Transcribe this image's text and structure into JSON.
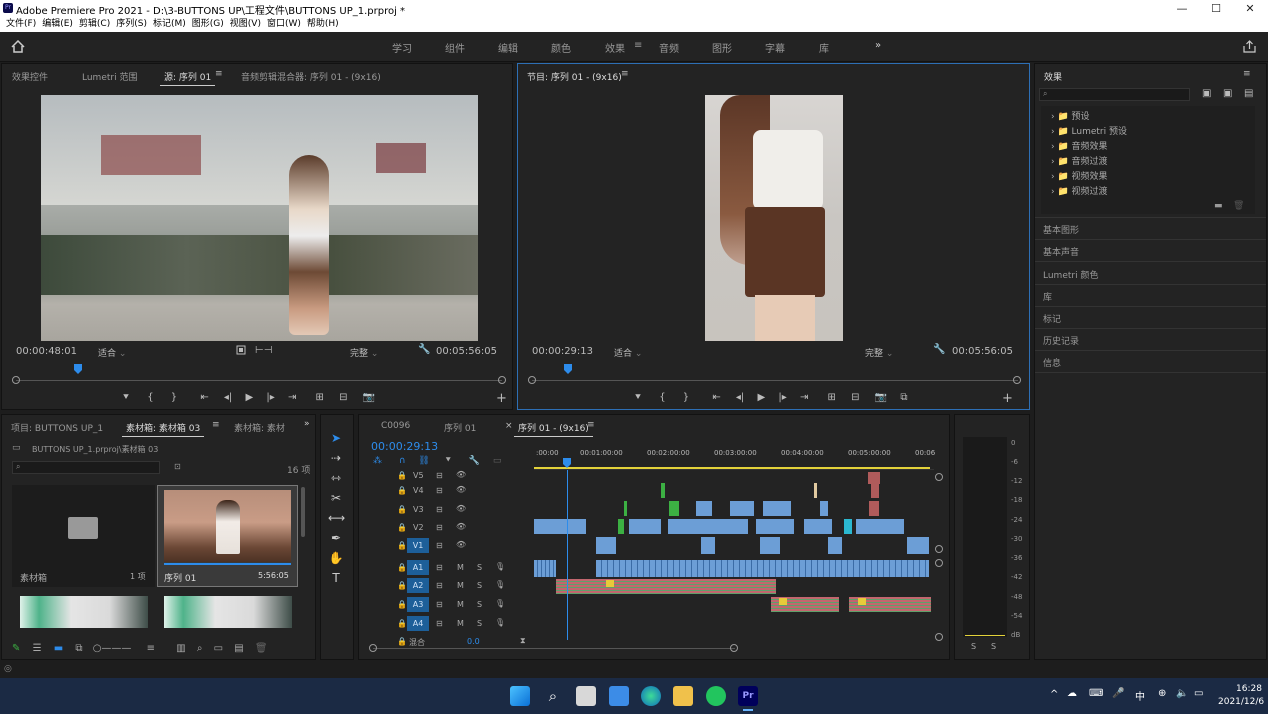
{
  "window": {
    "title": "Adobe Premiere Pro 2021 - D:\\3-BUTTONS UP\\工程文件\\BUTTONS UP_1.prproj *",
    "logo": "Pr"
  },
  "menu": [
    "文件(F)",
    "编辑(E)",
    "剪辑(C)",
    "序列(S)",
    "标记(M)",
    "图形(G)",
    "视图(V)",
    "窗口(W)",
    "帮助(H)"
  ],
  "workspaces": [
    {
      "label": "学习",
      "active": false
    },
    {
      "label": "组件",
      "active": false
    },
    {
      "label": "编辑",
      "active": false
    },
    {
      "label": "颜色",
      "active": false
    },
    {
      "label": "效果",
      "active": true
    },
    {
      "label": "音频",
      "active": false
    },
    {
      "label": "图形",
      "active": false
    },
    {
      "label": "字幕",
      "active": false
    },
    {
      "label": "库",
      "active": false
    }
  ],
  "source": {
    "tabs": [
      "效果控件",
      "Lumetri 范围",
      "源: 序列 01",
      "音频剪辑混合器: 序列 01 - (9x16)"
    ],
    "timecode": "00:00:48:01",
    "fit": "适合",
    "quality": "完整",
    "duration": "00:05:56:05"
  },
  "program": {
    "title": "节目: 序列 01 - (9x16)",
    "timecode": "00:00:29:13",
    "fit": "适合",
    "quality": "完整",
    "duration": "00:05:56:05"
  },
  "effects": {
    "title": "效果",
    "tree": [
      "预设",
      "Lumetri 预设",
      "音频效果",
      "音频过渡",
      "视频效果",
      "视频过渡"
    ],
    "sections": [
      "基本图形",
      "基本声音",
      "Lumetri 颜色",
      "库",
      "标记",
      "历史记录",
      "信息"
    ]
  },
  "project": {
    "tabs": [
      "项目: BUTTONS UP_1",
      "素材箱: 素材箱 03",
      "素材箱: 素材"
    ],
    "path": "BUTTONS UP_1.prproj\\素材箱 03",
    "count": "16 项",
    "bin": {
      "name": "素材箱",
      "count": "1 项"
    },
    "seq": {
      "name": "序列 01",
      "duration": "5:56:05"
    }
  },
  "timeline": {
    "tabs": [
      "C0096",
      "序列 01",
      "序列 01 - (9x16)"
    ],
    "timecode": "00:00:29:13",
    "ruler": [
      ":00:00",
      "00:01:00:00",
      "00:02:00:00",
      "00:03:00:00",
      "00:04:00:00",
      "00:05:00:00",
      "00:06"
    ],
    "video_tracks": [
      "V5",
      "V4",
      "V3",
      "V2",
      "V1"
    ],
    "audio_tracks": [
      "A1",
      "A2",
      "A3",
      "A4"
    ],
    "mix_label": "混合",
    "mix_value": "0.0",
    "track_m": "M",
    "track_s": "S"
  },
  "meter": {
    "scale": [
      "0",
      "-6",
      "-12",
      "-18",
      "-24",
      "-30",
      "-36",
      "-42",
      "-48",
      "-54",
      "dB"
    ],
    "solo": [
      "S",
      "S"
    ]
  },
  "taskbar": {
    "ime": "中",
    "time": "16:28",
    "date": "2021/12/6"
  },
  "colors": {
    "accent": "#2d8ceb",
    "panel": "#232323",
    "clip_video": "#6c9ed6",
    "clip_audio_pink": "#c2666e"
  }
}
